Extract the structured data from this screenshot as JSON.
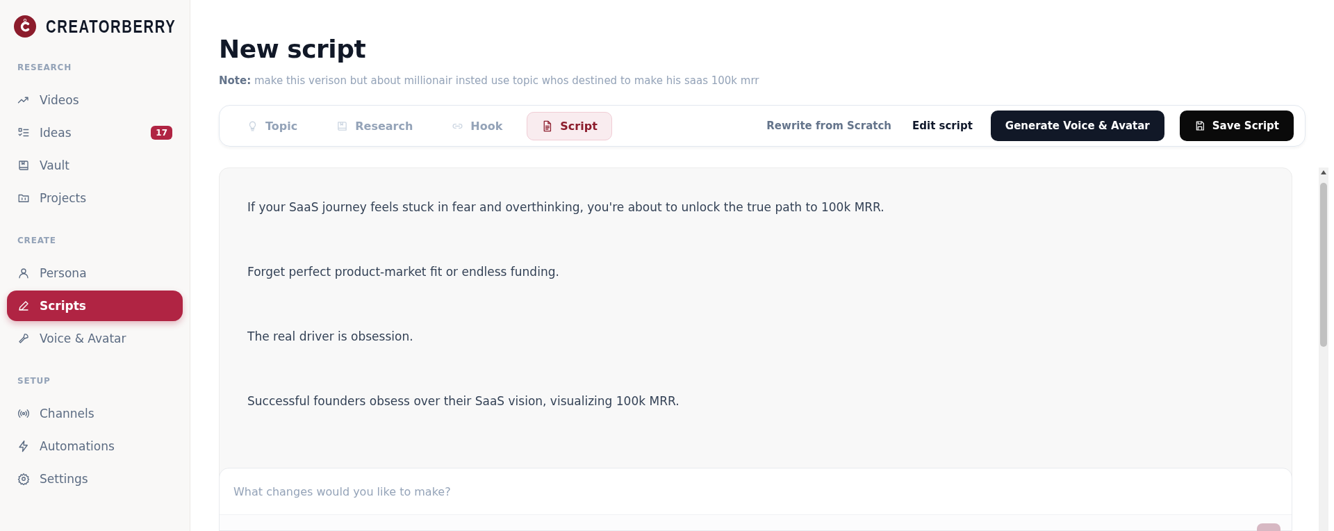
{
  "brand": {
    "name": "CREATORBERRY"
  },
  "sidebar": {
    "sections": [
      {
        "title": "RESEARCH",
        "items": [
          {
            "label": "Videos",
            "kind": "trend",
            "selected": false
          },
          {
            "label": "Ideas",
            "kind": "checklist",
            "selected": false,
            "badge": "17"
          },
          {
            "label": "Vault",
            "kind": "book",
            "selected": false
          },
          {
            "label": "Projects",
            "kind": "folder",
            "selected": false
          }
        ]
      },
      {
        "title": "CREATE",
        "items": [
          {
            "label": "Persona",
            "kind": "user",
            "selected": false
          },
          {
            "label": "Scripts",
            "kind": "pen",
            "selected": true
          },
          {
            "label": "Voice & Avatar",
            "kind": "mic",
            "selected": false
          }
        ]
      },
      {
        "title": "SETUP",
        "items": [
          {
            "label": "Channels",
            "kind": "radio",
            "selected": false
          },
          {
            "label": "Automations",
            "kind": "bolt",
            "selected": false
          },
          {
            "label": "Settings",
            "kind": "gear",
            "selected": false
          }
        ]
      }
    ]
  },
  "page": {
    "title": "New script",
    "note_label": "Note:",
    "note": "make this verison but about millionair insted use topic whos destined to make his saas 100k mrr"
  },
  "steps": [
    {
      "label": "Topic",
      "kind": "bulb",
      "selected": false
    },
    {
      "label": "Research",
      "kind": "book",
      "selected": false
    },
    {
      "label": "Hook",
      "kind": "link",
      "selected": false
    },
    {
      "label": "Script",
      "kind": "doc",
      "selected": true
    }
  ],
  "actions": [
    {
      "label": "Rewrite from Scratch",
      "kind": "muted"
    },
    {
      "label": "Edit script",
      "kind": "text"
    },
    {
      "label": "Generate Voice & Avatar",
      "kind": "dark"
    },
    {
      "label": "Save Script",
      "kind": "save"
    }
  ],
  "script": {
    "paragraphs": [
      "If your SaaS journey feels stuck in fear and overthinking, you're about to unlock the true path to 100k MRR.",
      "Forget perfect product-market fit or endless funding.",
      "The real driver is obsession.",
      "Successful founders obsess over their SaaS vision, visualizing 100k MRR."
    ]
  },
  "changes": {
    "placeholder": "What changes would you like to make?"
  }
}
